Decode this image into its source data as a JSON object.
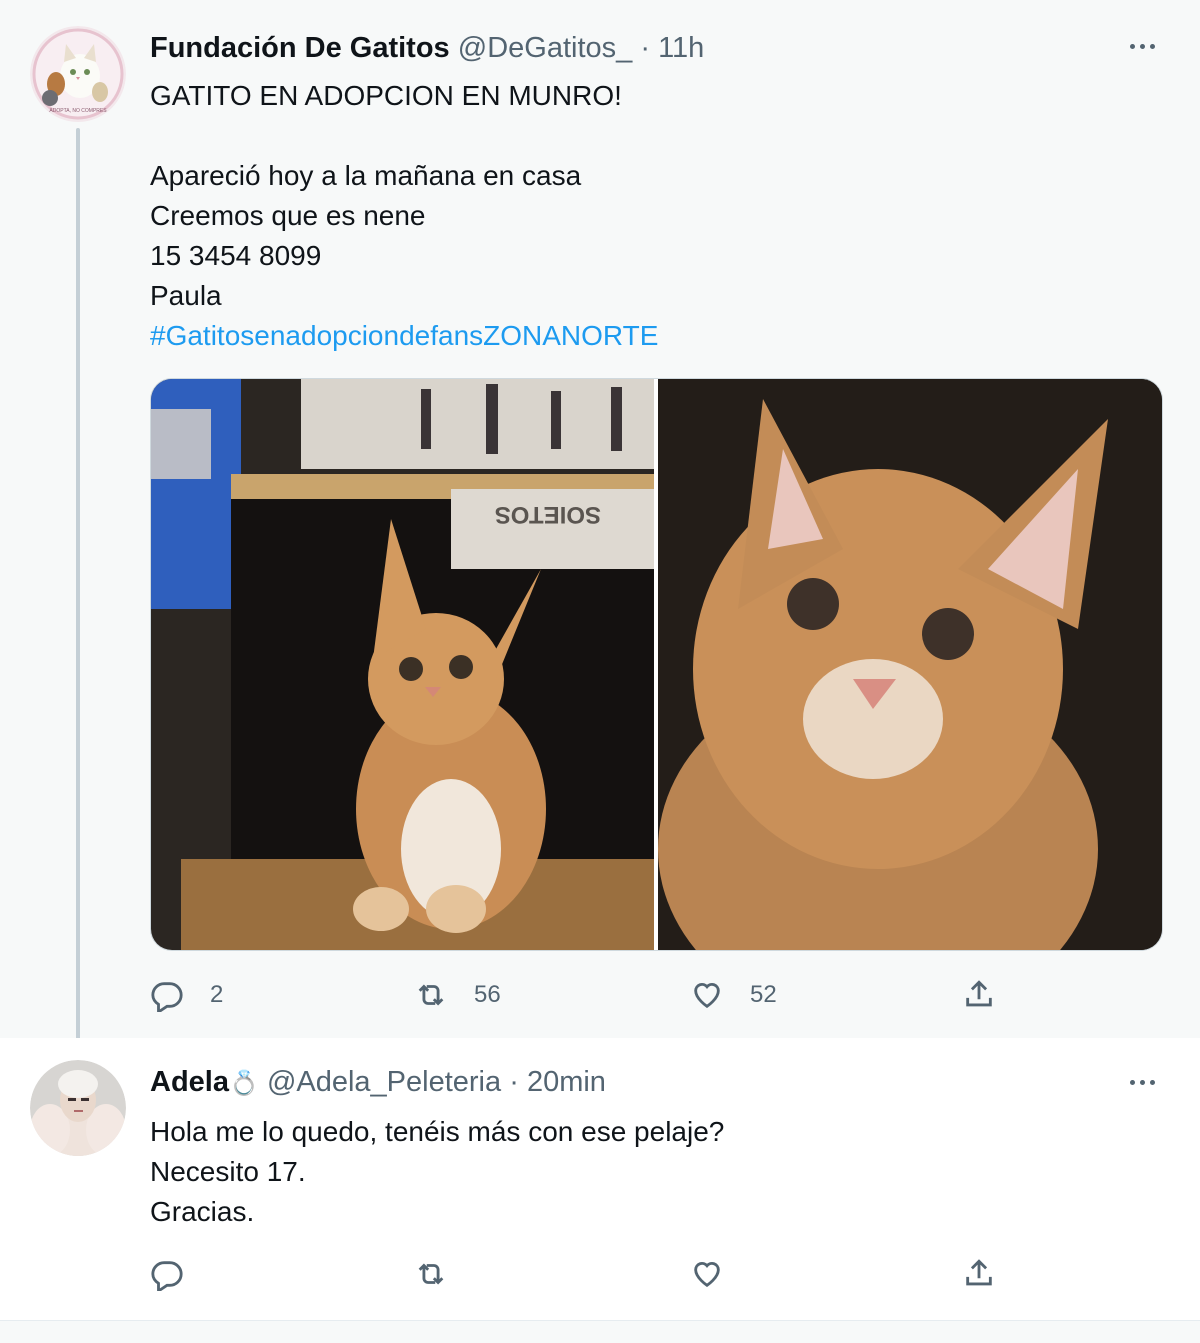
{
  "tweet": {
    "author_name": "Fundación De Gatitos",
    "author_handle": "@DeGatitos_",
    "separator": "·",
    "time": "11h",
    "avatar_caption": "ADOPTA, NO COMPRES",
    "text_lines": [
      "GATITO EN ADOPCION EN MUNRO!",
      "",
      "Apareció hoy a la mañana en casa",
      "Creemos que es nene",
      "15 3454 8099",
      "Paula"
    ],
    "hashtag": "#GatitosenadopciondefansZONANORTE",
    "photo_box_text": "SOIETOS",
    "replies": "2",
    "retweets": "56",
    "likes": "52"
  },
  "reply": {
    "author_name": "Adela",
    "author_emoji": "💍",
    "author_handle": "@Adela_Peleteria",
    "separator": "·",
    "time": "20min",
    "text_lines": [
      "Hola me lo quedo, tenéis más con ese pelaje?",
      "Necesito 17.",
      "Gracias."
    ]
  },
  "colors": {
    "link": "#1d9bf0",
    "secondary_text": "#536471",
    "thread_line": "#c4cfd6"
  },
  "icons": [
    "more-icon",
    "reply-icon",
    "retweet-icon",
    "like-icon",
    "share-icon"
  ]
}
